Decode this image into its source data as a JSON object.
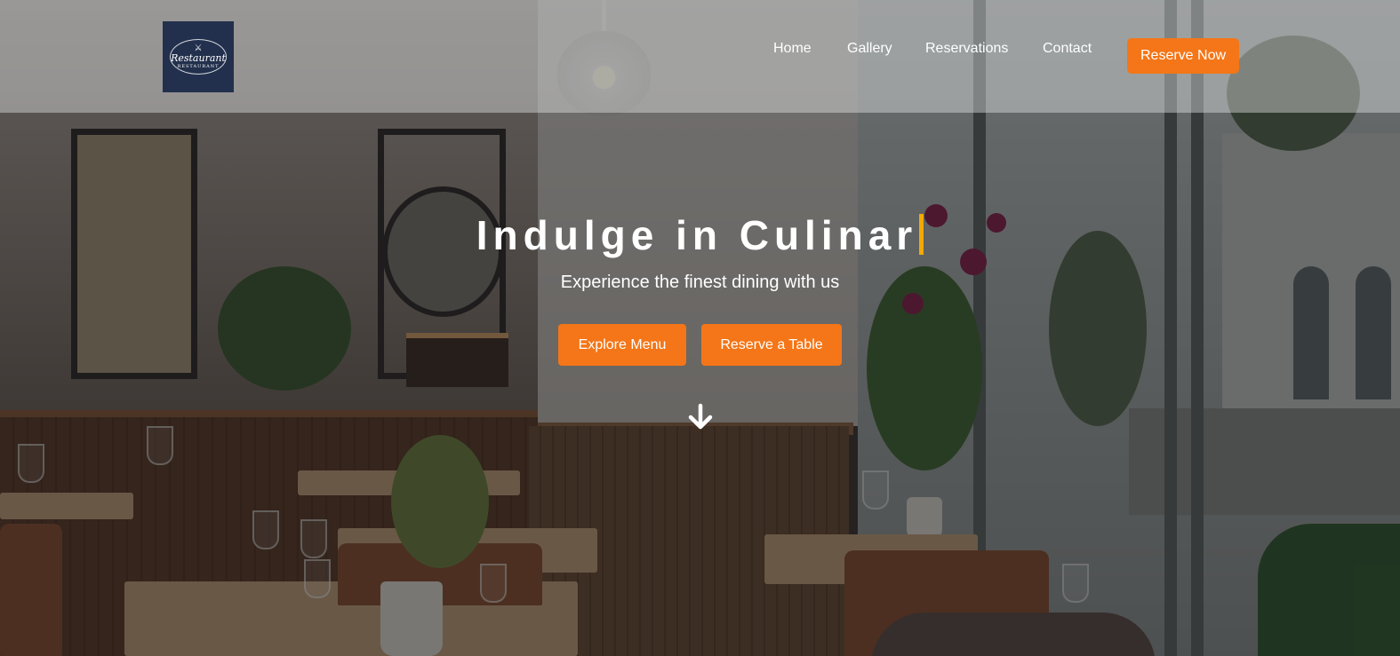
{
  "header": {
    "logo": {
      "text_script": "Restaurant",
      "text_caps": "RESTAURANT",
      "icon": "restaurant-logo-icon"
    },
    "nav": [
      {
        "label": "Home"
      },
      {
        "label": "Gallery"
      },
      {
        "label": "Reservations"
      },
      {
        "label": "Contact"
      }
    ],
    "cta_label": "Reserve Now"
  },
  "hero": {
    "title": "Indulge in Culinar",
    "subtitle": "Experience the finest dining with us",
    "buttons": [
      {
        "label": "Explore Menu"
      },
      {
        "label": "Reserve a Table"
      }
    ],
    "scroll_icon": "arrow-down-icon"
  },
  "colors": {
    "accent": "#f47618",
    "cursor": "#f2a900",
    "logo_bg": "#22304d"
  }
}
